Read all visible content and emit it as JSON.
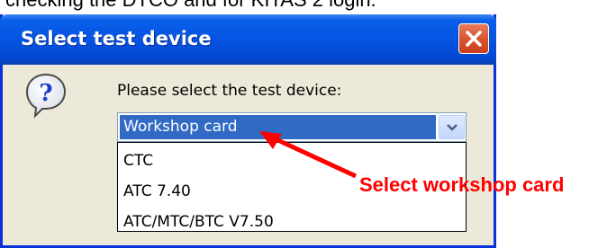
{
  "caption": "checking the DTCO and for KITAS 2 login.",
  "dialog": {
    "title": "Select test device",
    "prompt": "Please select the test device:",
    "selected_value": "Workshop card",
    "options": [
      "CTC",
      "ATC 7.40",
      "ATC/MTC/BTC V7.50"
    ]
  },
  "annotation": {
    "text": "Select workshop card",
    "color": "#ff0000"
  },
  "colors": {
    "titlebar": "#0554e3",
    "selection": "#316ac5",
    "close": "#d8532b"
  },
  "icons": [
    "question-icon",
    "close-icon",
    "chevron-down-icon",
    "red-arrow"
  ]
}
